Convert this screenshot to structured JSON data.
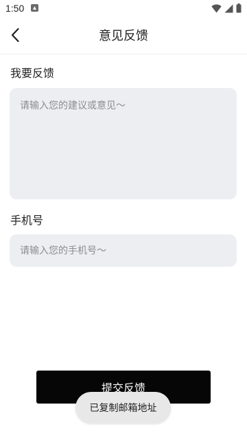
{
  "status_bar": {
    "time": "1:50",
    "notification_icon": "a-app-icon",
    "icons": [
      "wifi-icon",
      "signal-icon",
      "battery-icon"
    ]
  },
  "header": {
    "back_icon": "chevron-left-icon",
    "title": "意见反馈"
  },
  "feedback": {
    "label": "我要反馈",
    "value": "",
    "placeholder": "请输入您的建议或意见～"
  },
  "phone": {
    "label": "手机号",
    "value": "",
    "placeholder": "请输入您的手机号～"
  },
  "submit": {
    "label": "提交反馈"
  },
  "toast": {
    "text": "已复制邮箱地址"
  },
  "colors": {
    "input_background": "#eceef2",
    "button_background": "#060606",
    "toast_background": "#e8e8e8"
  }
}
